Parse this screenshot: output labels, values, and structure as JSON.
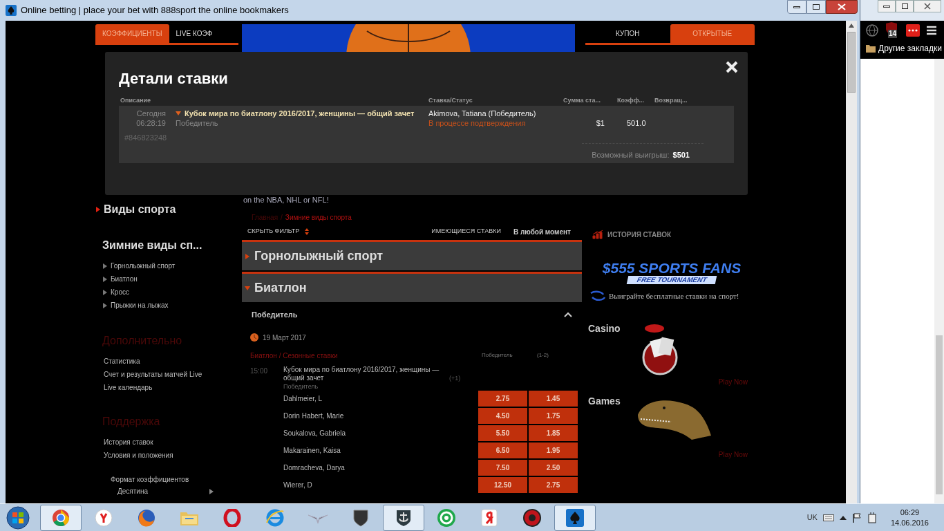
{
  "window": {
    "title": "Online betting | place your bet with 888sport the online bookmakers"
  },
  "browser_behind": {
    "badge": "14",
    "bookmark": "Другие закладки"
  },
  "page": {
    "left_tabs": [
      {
        "label": "КОЭФФИЦИЕНТЫ",
        "selected": true
      },
      {
        "label": "LIVE КОЭФ",
        "selected": false
      }
    ],
    "coupon_tabs": [
      {
        "label": "КУПОН",
        "selected": false
      },
      {
        "label": "ОТКРЫТЫЕ",
        "selected": true
      }
    ],
    "banner_caption": "on the NBA, NHL or NFL!",
    "sidebar": {
      "sports_link": "Виды спорта",
      "category_title": "Зимние виды сп...",
      "sports": [
        "Горнолыжный спорт",
        "Биатлон",
        "Кросс",
        "Прыжки на лыжах"
      ],
      "extra_title": "Дополнительно",
      "extra_links": [
        "Статистика",
        "Счет и результаты матчей Live",
        "Live календарь"
      ],
      "support_title": "Поддержка",
      "support_links": [
        "История ставок",
        "Условия и положения"
      ],
      "odds_format_label": "Формат коэффициентов",
      "odds_format_value": "Десятина"
    },
    "breadcrumb": {
      "home": "Главная",
      "separator": "/",
      "current": "Зимние виды спорта"
    },
    "filter_bar": {
      "hide_filter": "СКРЫТЬ ФИЛЬТР",
      "available_bets": "ИМЕЮЩИЕСЯ СТАВКИ",
      "time_filter": "В любой момент"
    },
    "sections": [
      {
        "title": "Горнолыжный спорт",
        "expanded": false
      },
      {
        "title": "Биатлон",
        "expanded": true
      }
    ],
    "market": {
      "title": "Победитель",
      "expanded": true,
      "date": "19 Март 2017",
      "category": "Биатлон / Сезонные ставки",
      "col_headers": [
        "Победитель",
        "(1-2)"
      ],
      "event": {
        "time": "15:00",
        "name": "Кубок мира по биатлону 2016/2017, женщины — общий зачет",
        "more": "(+1)",
        "sub": "Победитель"
      },
      "selections": [
        {
          "name": "Dahlmeier, L",
          "odds": [
            "2.75",
            "1.45"
          ]
        },
        {
          "name": "Dorin Habert, Marie",
          "odds": [
            "4.50",
            "1.75"
          ]
        },
        {
          "name": "Soukalova, Gabriela",
          "odds": [
            "5.50",
            "1.85"
          ]
        },
        {
          "name": "Makarainen, Kaisa",
          "odds": [
            "6.50",
            "1.95"
          ]
        },
        {
          "name": "Domracheva, Darya",
          "odds": [
            "7.50",
            "2.50"
          ]
        },
        {
          "name": "Wierer, D",
          "odds": [
            "12.50",
            "2.75"
          ]
        }
      ]
    },
    "right": {
      "history": "ИСТОРИЯ СТАВОК",
      "promo_title": "$555 SPORTS FANS",
      "promo_sub": "FREE TOURNAMENT",
      "promo_text": "Выиграйте бесплатные ставки на спорт!",
      "promos": [
        {
          "title": "Casino",
          "cta": "Play Now",
          "kind": "casino"
        },
        {
          "title": "Games",
          "cta": "Play Now",
          "kind": "games"
        }
      ]
    }
  },
  "modal": {
    "title": "Детали ставки",
    "columns": [
      "Описание",
      "Ставка/Статус",
      "Сумма ста...",
      "Коэфф...",
      "Возвращ..."
    ],
    "bet": {
      "day": "Сегодня",
      "time": "06:28:19",
      "expanded": true,
      "event": "Кубок мира по биатлону 2016/2017, женщины — общий зачет",
      "market": "Победитель",
      "selection": "Akimova, Tatiana (Победитель)",
      "status": "В процессе подтверждения",
      "stake": "$1",
      "odds": "501.0",
      "id": "#846823248",
      "win_label": "Возможный выигрыш:",
      "win_value": "$501"
    }
  },
  "taskbar": {
    "apps": [
      {
        "kind": "ring",
        "selected": true
      },
      {
        "kind": "red-circle",
        "selected": false
      },
      {
        "kind": "fox",
        "selected": false
      },
      {
        "kind": "folder",
        "selected": false
      },
      {
        "kind": "o-ring",
        "selected": false
      },
      {
        "kind": "e-globe",
        "selected": false
      },
      {
        "kind": "wings",
        "selected": false
      },
      {
        "kind": "tank",
        "selected": false
      },
      {
        "kind": "ship",
        "selected": true
      },
      {
        "kind": "at",
        "selected": false
      },
      {
        "kind": "red-tile",
        "selected": false
      },
      {
        "kind": "gear",
        "selected": false
      },
      {
        "kind": "spade",
        "selected": true
      }
    ],
    "language": "UK",
    "time": "06:29",
    "date": "14.06.2016"
  }
}
